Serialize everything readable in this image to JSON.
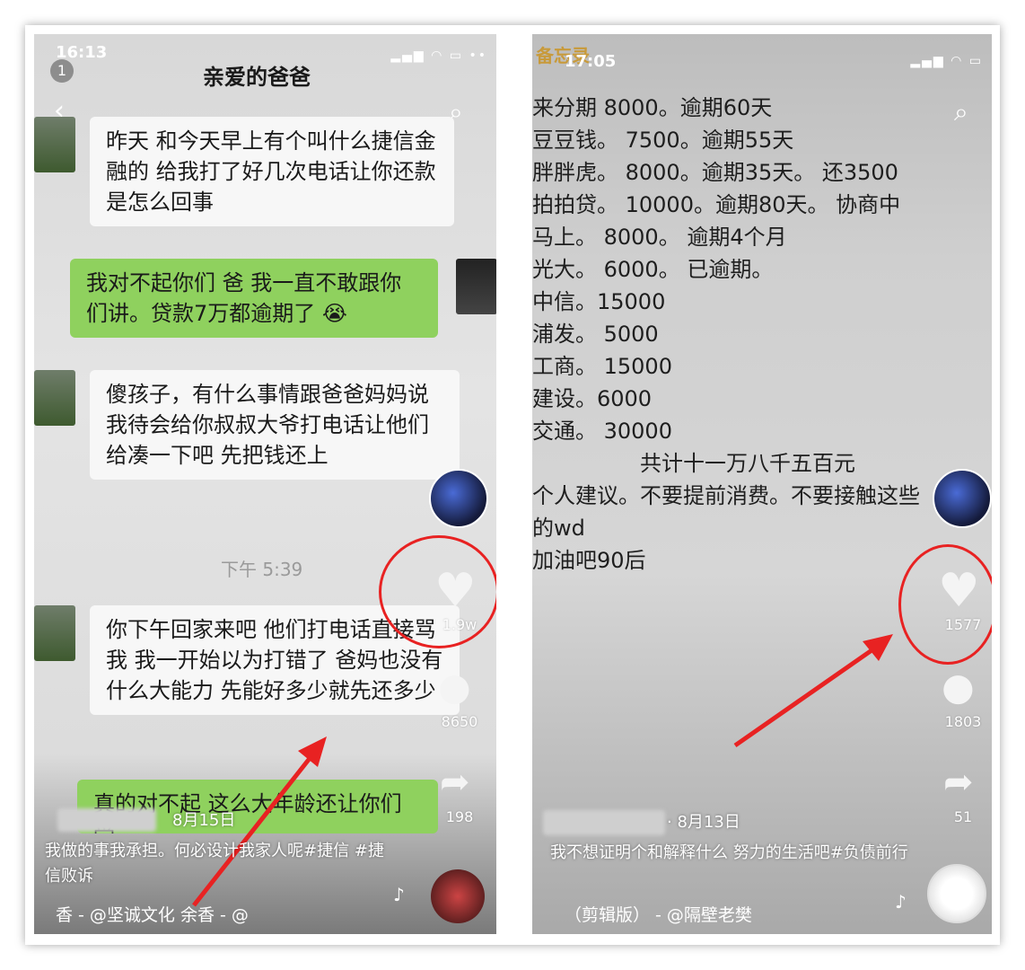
{
  "left": {
    "status": {
      "time": "16:13",
      "badge": "1"
    },
    "title": "亲爱的爸爸",
    "messages": [
      {
        "text": "昨天 和今天早上有个叫什么捷信金融的 给我打了好几次电话让你还款是怎么回事"
      },
      {
        "text": "我对不起你们 爸 我一直不敢跟你们讲。贷款7万都逾期了 😭"
      },
      {
        "text": "傻孩子，有什么事情跟爸爸妈妈说 我待会给你叔叔大爷打电话让他们给凑一下吧 先把钱还上"
      },
      {
        "text": "你下午回家来吧 他们打电话直接骂我 我一开始以为打错了 爸妈也没有什么大能力 先能好多少就先还多少"
      },
      {
        "text": "真的对不起 这么大年龄还让你们受"
      }
    ],
    "time_divider": "下午 5:39",
    "likes": "1.9w",
    "comments": "8650",
    "shares": "198",
    "date": "8月15日",
    "caption": "我做的事我承担。何必设计我家人呢#捷信 #捷信败诉",
    "music": "香 - @坚诚文化    余香 - @"
  },
  "right": {
    "status": {
      "time": "17:05",
      "app": "备忘录"
    },
    "memo": [
      "来分期   8000。逾期60天",
      "豆豆钱。  7500。逾期55天",
      "胖胖虎。   8000。逾期35天。 还3500",
      "拍拍贷。   10000。逾期80天。 协商中",
      "马上。   8000。   逾期4个月",
      "光大。 6000。    已逾期。",
      "中信。15000",
      "浦发。  5000",
      "工商。  15000",
      "建设。6000",
      "交通。  30000"
    ],
    "total": "共计十一万八千五百元",
    "advice": [
      "个人建议。不要提前消费。不要接触这些",
      "的wd",
      "加油吧90后"
    ],
    "likes": "1577",
    "comments": "1803",
    "shares": "51",
    "date": "· 8月13日",
    "caption": "我不想证明个和解释什么 努力的生活吧#负债前行",
    "music": "（剪辑版） - @隔壁老樊"
  },
  "icons": {
    "heart": "heart-icon",
    "comment": "comment-icon",
    "share": "share-icon",
    "search": "search-icon",
    "back": "back-icon",
    "music": "music-note-icon"
  },
  "colors": {
    "highlight": "#e82222",
    "wechat_green": "#8fd15e"
  }
}
